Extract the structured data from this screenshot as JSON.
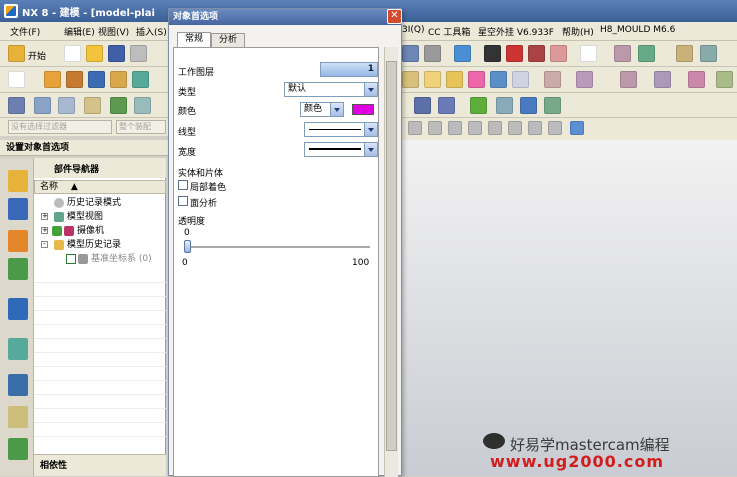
{
  "window": {
    "title": "NX 8 - 建模 - [model-plai"
  },
  "menubar": {
    "items": [
      "文件(F)",
      "编辑(E)",
      "视图(V)",
      "插入(S)"
    ],
    "right_items": [
      "3I(Q)",
      "CC 工具箱",
      "星空外挂 V6.933F",
      "帮助(H)",
      "H8_MOULD M6.6"
    ]
  },
  "toolbar": {
    "start_label": "开始"
  },
  "settings_caption": "设置对象首选项",
  "filter": {
    "left": "没有选择过滤器",
    "right": "整个装配"
  },
  "navigator": {
    "title": "部件导航器",
    "column_header": "名称",
    "rows": [
      {
        "label": "历史记录模式",
        "indent": 1
      },
      {
        "label": "模型视图",
        "indent": 0,
        "expand": "+"
      },
      {
        "label": "摄像机",
        "indent": 0,
        "expand": "+"
      },
      {
        "label": "模型历史记录",
        "indent": 0,
        "expand": "-"
      },
      {
        "label": "基准坐标系 (0)",
        "indent": 2
      }
    ],
    "dependency": "相依性"
  },
  "dialog": {
    "title": "对象首选项",
    "close_glyph": "✕",
    "tabs": [
      "常规",
      "分析"
    ],
    "work_layer_label": "工作图层",
    "work_layer_value": "1",
    "type_label": "类型",
    "type_value": "默认",
    "color_label": "颜色",
    "color_value_text": "颜色",
    "color_swatch": "#e000e0",
    "linetype_label": "线型",
    "width_label": "宽度",
    "solids_title": "实体和片体",
    "partial_shading": "局部着色",
    "face_analysis": "面分析",
    "transparency_label": "透明度",
    "slider_min": "0",
    "slider_max": "100",
    "slider_value_label": "0",
    "slider_value": 0
  },
  "watermark": {
    "line1": "好易学mastercam编程",
    "line2": "www.ug2000.com"
  }
}
